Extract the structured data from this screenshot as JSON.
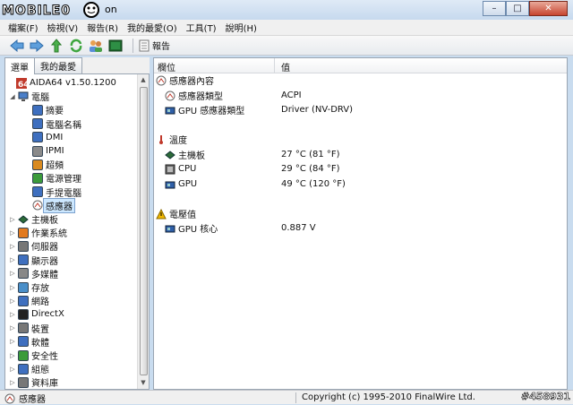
{
  "window": {
    "title_fragment": "on",
    "logo_text": "MOBILE01",
    "buttons": {
      "minimize": "–",
      "maximize": "□",
      "close": "✕"
    }
  },
  "menubar": {
    "items": [
      "檔案(F)",
      "檢視(V)",
      "報告(R)",
      "我的最愛(O)",
      "工具(T)",
      "說明(H)"
    ]
  },
  "toolbar": {
    "icons": [
      "back-arrow-icon",
      "forward-arrow-icon",
      "up-arrow-icon",
      "refresh-icon",
      "users-icon",
      "chip-icon"
    ],
    "report_label": "報告"
  },
  "tabs": [
    "選單",
    "我的最愛"
  ],
  "tree": {
    "root": "AIDA64 v1.50.1200",
    "computer": "電腦",
    "computer_children": [
      "摘要",
      "電腦名稱",
      "DMI",
      "IPMI",
      "超頻",
      "電源管理",
      "手提電腦",
      "感應器"
    ],
    "selected": "感應器",
    "others": [
      "主機板",
      "作業系統",
      "伺服器",
      "顯示器",
      "多媒體",
      "存放",
      "網路",
      "DirectX",
      "裝置",
      "軟體",
      "安全性",
      "組態",
      "資料庫"
    ]
  },
  "columns": {
    "field": "欄位",
    "value": "值"
  },
  "groups": [
    {
      "title": "感應器內容",
      "icon": "sensor-icon",
      "rows": [
        {
          "label": "感應器類型",
          "value": "ACPI",
          "icon": "sensor-icon"
        },
        {
          "label": "GPU 感應器類型",
          "value": "Driver  (NV-DRV)",
          "icon": "gpu-icon"
        }
      ]
    },
    {
      "title": "溫度",
      "icon": "thermometer-icon",
      "rows": [
        {
          "label": "主機板",
          "value": "27 °C  (81 °F)",
          "icon": "motherboard-icon"
        },
        {
          "label": "CPU",
          "value": "29 °C  (84 °F)",
          "icon": "cpu-icon"
        },
        {
          "label": "GPU",
          "value": "49 °C  (120 °F)",
          "icon": "gpu-icon"
        }
      ]
    },
    {
      "title": "電壓值",
      "icon": "warning-icon",
      "rows": [
        {
          "label": "GPU 核心",
          "value": "0.887 V",
          "icon": "gpu-icon"
        }
      ]
    }
  ],
  "statusbar": {
    "left": "感應器",
    "copyright": "Copyright (c) 1995-2010 FinalWire Ltd.",
    "watermark": "#458931"
  },
  "colors": {
    "title_bg": "#c6d9ee",
    "close_button": "#c7452f",
    "selection": "#cde8ff",
    "warning": "#f2b800"
  }
}
